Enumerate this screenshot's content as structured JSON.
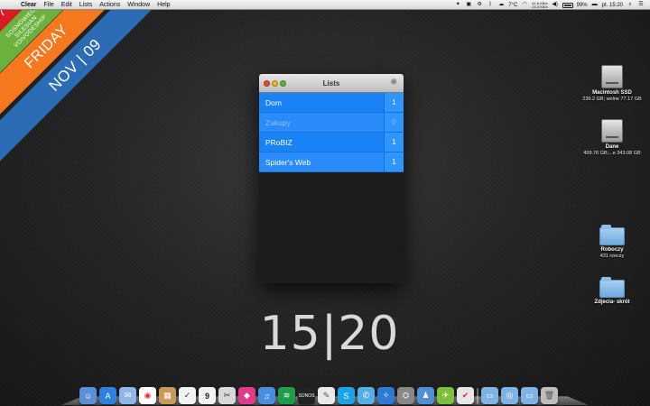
{
  "menubar": {
    "app_name": "Clear",
    "items": [
      "File",
      "Edit",
      "Lists",
      "Actions",
      "Window",
      "Help"
    ],
    "temperature": "7°C",
    "network_up": "41.6 KB/s",
    "network_down": "24.3 KB/s",
    "battery": "99%",
    "clock": "pt. 15:20"
  },
  "weather_ribbon": {
    "temperature": "7°",
    "location": "SOSNOWIEC, SILESIAN VOIVODESHIP",
    "day": "FRIDAY",
    "date": "NOV | 09",
    "colors": [
      "#d91b26",
      "#6ab23c",
      "#f5781f",
      "#2b6cb5"
    ]
  },
  "lists_window": {
    "title": "Lists",
    "rows": [
      {
        "name": "Dom",
        "count": "1"
      },
      {
        "name": "Zakupy",
        "count": "0"
      },
      {
        "name": "PRoBIZ",
        "count": "1"
      },
      {
        "name": "Spider's Web",
        "count": "1"
      }
    ]
  },
  "desktop_icons": [
    {
      "name": "Macintosh SSD",
      "sub": "239.2 GB; wolne 77.17 GB",
      "icon": "hard-drive-icon"
    },
    {
      "name": "Dane",
      "sub": "499.76 GB;...e 343.08 GB",
      "icon": "hard-drive-icon"
    },
    {
      "name": "Roboczy",
      "sub": "431 rzeczy",
      "icon": "folder-icon"
    },
    {
      "name": "Zdjecia- skrót",
      "sub": "",
      "icon": "folder-icon"
    }
  ],
  "big_clock": "15|20",
  "dock": {
    "badge_calendar_day": "9",
    "apps": [
      "finder",
      "app-store",
      "mail",
      "chrome",
      "package",
      "calendar-badge",
      "ical",
      "preview",
      "itunes",
      "music",
      "spotify",
      "sonos",
      "textedit",
      "skype",
      "twitter",
      "safari",
      "sync",
      "game-center",
      "chat",
      "task-check",
      "folder",
      "downloads",
      "documents",
      "trash"
    ]
  }
}
